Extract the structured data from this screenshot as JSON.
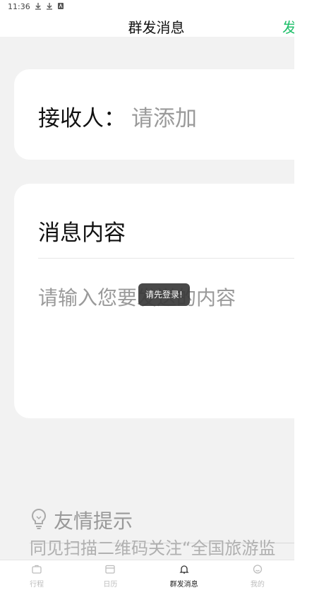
{
  "status_bar": {
    "time": "11:36"
  },
  "nav": {
    "title": "群发消息",
    "send": "发"
  },
  "receiver": {
    "label": "接收人：",
    "placeholder": "请添加"
  },
  "message": {
    "title": "消息内容",
    "placeholder": "请输入您要发送的内容"
  },
  "toast": "请先登录!",
  "tips": {
    "title": "友情提示",
    "text": "同见扫描二维码关注“全国旅游监"
  },
  "tabs": [
    {
      "label": "行程",
      "icon": "suitcase-icon"
    },
    {
      "label": "日历",
      "icon": "calendar-icon"
    },
    {
      "label": "群发消息",
      "icon": "bell-icon"
    },
    {
      "label": "我的",
      "icon": "smile-icon"
    }
  ],
  "colors": {
    "accent": "#1fbf6a",
    "background": "#f2f2f2"
  }
}
